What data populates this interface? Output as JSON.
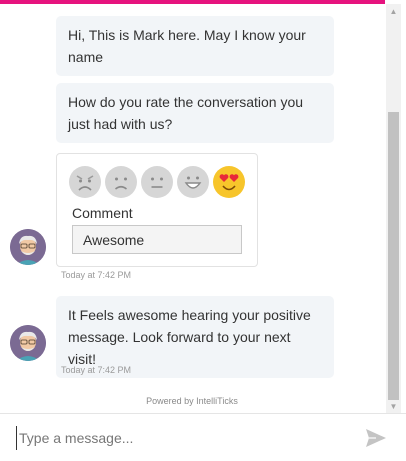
{
  "chat": {
    "messages": [
      {
        "text": "Hi, This is Mark here. May I know your name"
      },
      {
        "text": "How do you rate the conversation you just had with us?"
      },
      {
        "text": "It Feels awesome hearing your positive message. Look forward to your next visit!"
      }
    ],
    "timestamps": [
      "Today at 7:42 PM",
      "Today at 7:42 PM"
    ]
  },
  "rating": {
    "options": [
      "angry-face-icon",
      "sad-face-icon",
      "neutral-face-icon",
      "happy-face-icon",
      "heart-eyes-face-icon"
    ],
    "selected_index": 4,
    "comment_label": "Comment",
    "comment_value": "Awesome"
  },
  "footer": {
    "powered_by": "Powered by IntelliTicks"
  },
  "composer": {
    "placeholder": "Type a message..."
  },
  "colors": {
    "accent": "#e6137e",
    "bubble_bg": "#f2f5f8",
    "selected_emoji": "#f7c52b",
    "inactive_emoji": "#d6d6d6",
    "avatar_bg": "#7b6a93"
  }
}
